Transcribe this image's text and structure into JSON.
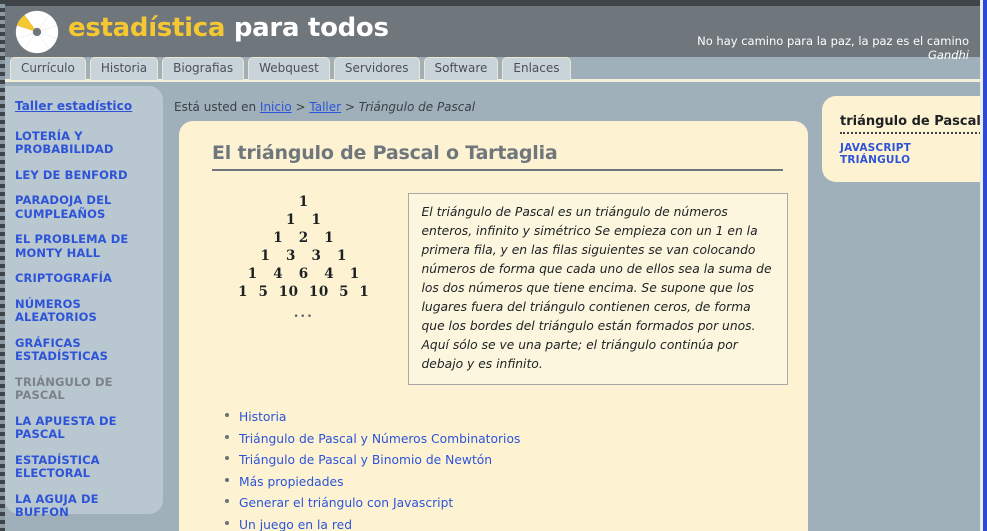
{
  "site": {
    "brand_part1": "estadística",
    "brand_part2": "para todos",
    "logo_icon": "pinwheel-pie-logo",
    "motto": "No hay camino para la paz, la paz es el camino",
    "motto_author": "Gandhi"
  },
  "tabs": [
    {
      "label": "Currículo"
    },
    {
      "label": "Historia"
    },
    {
      "label": "Biografias"
    },
    {
      "label": "Webquest"
    },
    {
      "label": "Servidores"
    },
    {
      "label": "Software"
    },
    {
      "label": "Enlaces"
    }
  ],
  "sidebar": {
    "items": [
      {
        "label": "Taller estadístico",
        "state": "heading"
      },
      {
        "label": "LOTERÍA Y PROBABILIDAD",
        "state": "link"
      },
      {
        "label": "LEY DE BENFORD",
        "state": "link"
      },
      {
        "label": "PARADOJA DEL CUMPLEAÑOS",
        "state": "link"
      },
      {
        "label": "EL PROBLEMA DE MONTY HALL",
        "state": "link"
      },
      {
        "label": "CRIPTOGRAFÍA",
        "state": "link"
      },
      {
        "label": "NÚMEROS ALEATORIOS",
        "state": "link"
      },
      {
        "label": "GRÁFICAS ESTADÍSTICAS",
        "state": "link"
      },
      {
        "label": "TRIÁNGULO DE PASCAL",
        "state": "current"
      },
      {
        "label": "LA APUESTA DE PASCAL",
        "state": "link"
      },
      {
        "label": "ESTADÍSTICA ELECTORAL",
        "state": "link"
      },
      {
        "label": "LA AGUJA DE BUFFON",
        "state": "link"
      }
    ]
  },
  "breadcrumb": {
    "prefix": "Está usted en",
    "home": "Inicio",
    "sep1": ">",
    "section": "Taller",
    "sep2": ">",
    "current": "Triángulo de Pascal"
  },
  "main": {
    "title": "El triángulo de Pascal o Tartaglia",
    "triangle": {
      "rows": [
        "1",
        "1   1",
        "1   2   1",
        "1   3   3   1",
        "1   4   6   4   1",
        "1  5  10  10  5  1"
      ],
      "continuation": "..."
    },
    "description": "El triángulo de Pascal es un triángulo de números enteros, infinito y simétrico Se empieza con un 1 en la primera fila, y en las filas siguientes se van colocando números de forma que cada uno de ellos sea la suma de los dos números que tiene encima. Se supone que los lugares fuera del triángulo contienen ceros, de forma que los bordes del triángulo están formados por unos. Aquí sólo se ve una parte; el triángulo continúa por debajo y es infinito.",
    "links": [
      {
        "label": "Historia"
      },
      {
        "label": "Triángulo de Pascal y Números Combinatorios"
      },
      {
        "label": "Triángulo de Pascal y Binomio de Newtón"
      },
      {
        "label": "Más propiedades"
      },
      {
        "label": "Generar el triángulo con Javascript"
      },
      {
        "label": "Un juego en la red"
      }
    ]
  },
  "right_panel": {
    "title": "triángulo de Pascal",
    "link": "JAVASCRIPT TRIÁNGULO"
  },
  "colors": {
    "header_bg": "#6f767c",
    "brand_yellow": "#f5c832",
    "page_bg": "#9fb0bb",
    "sidebar_bg": "#b9c7d0",
    "panel_cream": "#fdf3d3",
    "link_blue": "#2d54d8"
  }
}
